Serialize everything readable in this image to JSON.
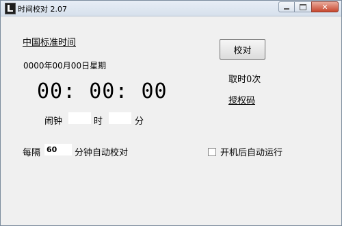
{
  "window": {
    "title": "时间校对 2.07"
  },
  "main": {
    "standard_time_link": "中国标准时间",
    "date_line": "0000年00月00日星期",
    "clock": "00: 00: 00",
    "alarm": {
      "label": "闹钟",
      "hour_value": "",
      "hour_unit": "时",
      "minute_value": "",
      "minute_unit": "分"
    },
    "interval": {
      "prefix": "每隔",
      "value": "60",
      "suffix": "分钟自动校对"
    },
    "calibrate_button": "校对",
    "count_text": "取时0次",
    "auth_link": "授权码",
    "autostart": {
      "label": "开机后自动运行",
      "checked": false
    }
  }
}
